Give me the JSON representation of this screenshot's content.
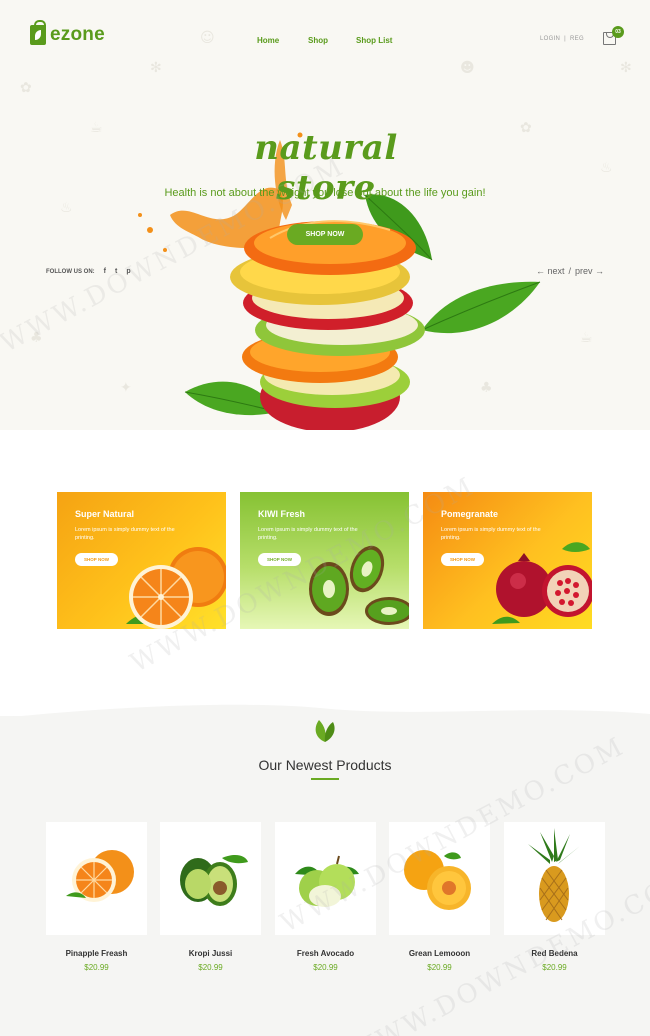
{
  "header": {
    "logo": "ezone",
    "nav": [
      "Home",
      "Shop",
      "Shop List"
    ],
    "login": "LOGIN",
    "sep": "|",
    "reg": "REG",
    "cart_count": "03"
  },
  "hero": {
    "title": "natural store",
    "subtitle": "Health is not about the weight you lose but about the life you gain!",
    "button": "SHOP NOW",
    "follow_label": "FOLLOW US ON:",
    "social": [
      "f",
      "t",
      "p"
    ],
    "next_label": "← next",
    "slash": "/",
    "prev_label": "prev →"
  },
  "banners": [
    {
      "title": "Super Natural",
      "text": "Lorem ipsum is simply dummy text of the printing.",
      "button": "SHOP NOW"
    },
    {
      "title": "KIWI Fresh",
      "text": "Lorem ipsum is simply dummy text of the printing.",
      "button": "SHOP NOW"
    },
    {
      "title": "Pomegranate",
      "text": "Lorem ipsum is simply dummy text of the printing.",
      "button": "SHOP NOW"
    }
  ],
  "products_section": {
    "title": "Our Newest Products",
    "items": [
      {
        "name": "Pinapple Freash",
        "price": "$20.99"
      },
      {
        "name": "Kropi Jussi",
        "price": "$20.99"
      },
      {
        "name": "Fresh Avocado",
        "price": "$20.99"
      },
      {
        "name": "Grean Lemooon",
        "price": "$20.99"
      },
      {
        "name": "Red Bedena",
        "price": "$20.99"
      }
    ]
  },
  "watermark": "WWW.DOWNDEMO.COM",
  "colors": {
    "accent": "#5a9b1c",
    "button": "#6aaa22",
    "orange": "#f5a313"
  }
}
